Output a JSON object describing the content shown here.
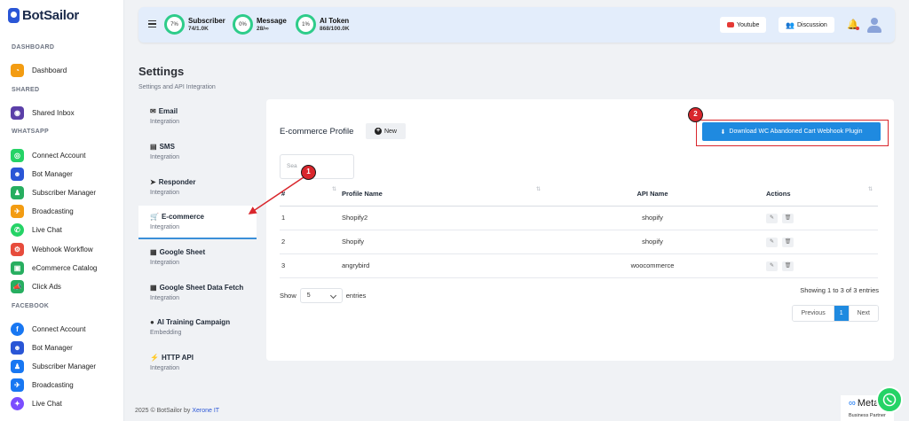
{
  "brand": {
    "name": "BotSailor"
  },
  "sidebar": {
    "sections": [
      {
        "title": "DASHBOARD",
        "items": [
          {
            "label": "Dashboard",
            "icon": "gauge-icon",
            "color": "#f39c12"
          }
        ]
      },
      {
        "title": "SHARED",
        "items": [
          {
            "label": "Shared Inbox",
            "icon": "inbox-icon",
            "color": "#5b3fa8"
          }
        ]
      },
      {
        "title": "WHATSAPP",
        "items": [
          {
            "label": "Connect Account",
            "icon": "whatsapp-icon",
            "color": "#25d366"
          },
          {
            "label": "Bot Manager",
            "icon": "bot-icon",
            "color": "#2a56d6"
          },
          {
            "label": "Subscriber Manager",
            "icon": "subscriber-icon",
            "color": "#27ae60"
          },
          {
            "label": "Broadcasting",
            "icon": "broadcast-icon",
            "color": "#f39c12"
          },
          {
            "label": "Live Chat",
            "icon": "chat-icon",
            "color": "#25d366"
          },
          {
            "label": "Webhook Workflow",
            "icon": "webhook-icon",
            "color": "#e74c3c"
          },
          {
            "label": "eCommerce Catalog",
            "icon": "catalog-icon",
            "color": "#27ae60"
          },
          {
            "label": "Click Ads",
            "icon": "megaphone-icon",
            "color": "#27ae60"
          }
        ]
      },
      {
        "title": "FACEBOOK",
        "items": [
          {
            "label": "Connect Account",
            "icon": "facebook-icon",
            "color": "#1877f2"
          },
          {
            "label": "Bot Manager",
            "icon": "bot-icon",
            "color": "#2a56d6"
          },
          {
            "label": "Subscriber Manager",
            "icon": "subscriber-icon",
            "color": "#1877f2"
          },
          {
            "label": "Broadcasting",
            "icon": "broadcast-icon",
            "color": "#1877f2"
          },
          {
            "label": "Live Chat",
            "icon": "messenger-icon",
            "color": "#7b4dff"
          }
        ]
      }
    ]
  },
  "header": {
    "stats": [
      {
        "name": "Subscriber",
        "percent": "7%",
        "value": "74/1.0K"
      },
      {
        "name": "Message",
        "percent": "0%",
        "value": "28/∞"
      },
      {
        "name": "AI Token",
        "percent": "1%",
        "value": "868/100.0K"
      }
    ],
    "youtube_label": "Youtube",
    "discussion_label": "Discussion"
  },
  "page": {
    "title": "Settings",
    "subtitle": "Settings and API Integration"
  },
  "settings_menu": [
    {
      "title": "Email",
      "sub": "Integration",
      "icon": "envelope-icon",
      "glyph": "✉"
    },
    {
      "title": "SMS",
      "sub": "Integration",
      "icon": "sms-icon",
      "glyph": "▤"
    },
    {
      "title": "Responder",
      "sub": "Integration",
      "icon": "paper-plane-icon",
      "glyph": "➤"
    },
    {
      "title": "E-commerce",
      "sub": "Integration",
      "icon": "cart-icon",
      "glyph": "🛒",
      "active": true
    },
    {
      "title": "Google Sheet",
      "sub": "Integration",
      "icon": "sheet-icon",
      "glyph": "▦"
    },
    {
      "title": "Google Sheet Data Fetch",
      "sub": "Integration",
      "icon": "sheet-icon",
      "glyph": "▦"
    },
    {
      "title": "AI Training Campaign",
      "sub": "Embedding",
      "icon": "bulb-icon",
      "glyph": "●"
    },
    {
      "title": "HTTP API",
      "sub": "Integration",
      "icon": "plug-icon",
      "glyph": "⚡"
    }
  ],
  "ecommerce": {
    "title": "E-commerce Profile",
    "new_label": "New",
    "download_label": "Download WC Abandoned Cart Webhook Plugin",
    "search_placeholder": "Search...",
    "search_visible": "Sea",
    "columns": [
      "#",
      "Profile Name",
      "API Name",
      "Actions"
    ],
    "rows": [
      {
        "num": "1",
        "profile": "Shopify2",
        "api": "shopify"
      },
      {
        "num": "2",
        "profile": "Shopify",
        "api": "shopify"
      },
      {
        "num": "3",
        "profile": "angrybird",
        "api": "woocommerce"
      }
    ],
    "show_label": "Show",
    "page_size": "5",
    "entries_label": "entries",
    "info": "Showing 1 to 3 of 3 entries",
    "prev_label": "Previous",
    "current_page": "1",
    "next_label": "Next"
  },
  "annotations": {
    "marker1": "1",
    "marker2": "2"
  },
  "footer": {
    "copyright": "2025 © BotSailor by",
    "company": "Xerone IT"
  },
  "meta_badge": {
    "brand": "Meta",
    "sub": "Business Partner"
  },
  "colors": {
    "accent": "#1f8ae0",
    "highlight": "#d9262c",
    "ring": "#2ecc8a"
  }
}
